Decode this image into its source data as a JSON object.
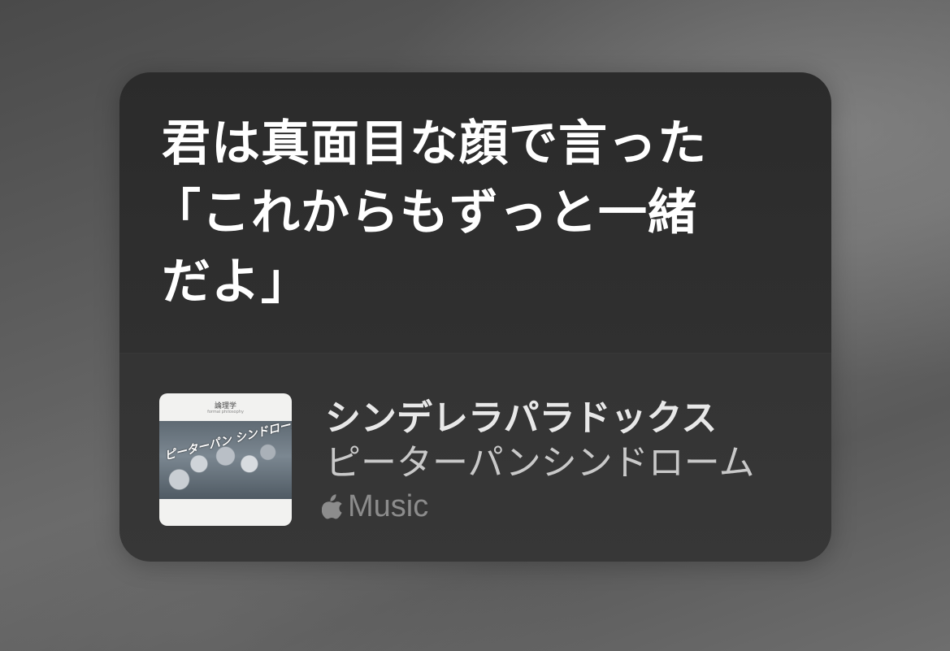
{
  "lyrics": {
    "lines": [
      "君は真面目な顔で言った",
      "「これからもずっと一緒",
      "だよ」"
    ]
  },
  "now_playing": {
    "song_title": "シンデレラパラドックス",
    "artist": "ピーターパンシンドローム",
    "service_label": "Music",
    "service_icon": "apple-logo-icon",
    "artwork": {
      "label": "論理学",
      "sub_label": "formal philosophy",
      "logo_text": "ピーターパン シンドローム"
    }
  }
}
